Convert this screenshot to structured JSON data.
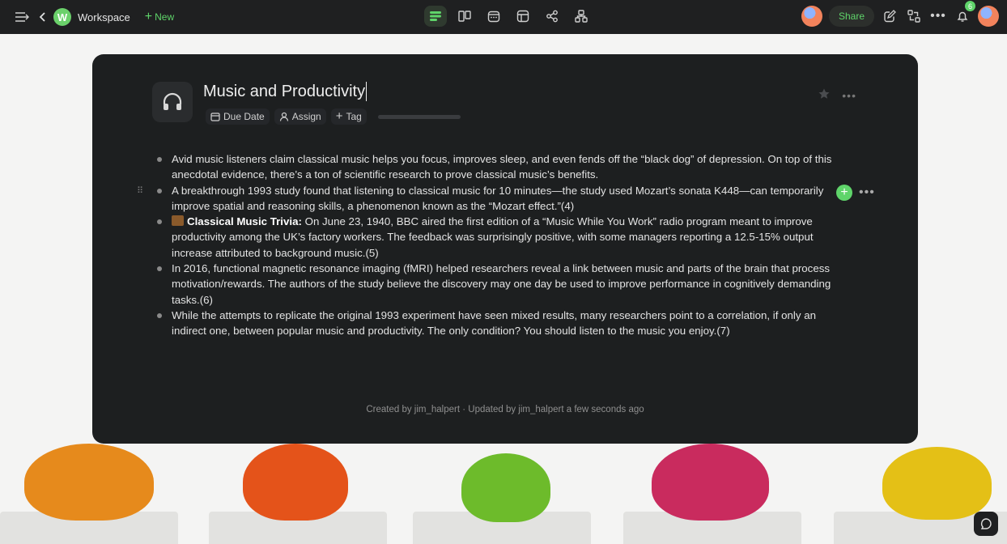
{
  "topbar": {
    "workspace_initial": "W",
    "workspace_name": "Workspace",
    "new_label": "New",
    "share_label": "Share",
    "notification_count": "6"
  },
  "doc": {
    "title": "Music and Productivity",
    "meta": {
      "due_date": "Due Date",
      "assign": "Assign",
      "tag": "Tag"
    },
    "bullets": [
      {
        "bold": "",
        "text": "Avid music listeners claim classical music helps you focus, improves sleep, and even fends off the “black dog” of depression. On top of this anecdotal evidence, there’s a ton of scientific research to prove classical music’s benefits."
      },
      {
        "bold": "",
        "text": "A breakthrough 1993 study found that listening to classical music for 10 minutes—the study used Mozart’s sonata K448—can temporarily improve spatial and reasoning skills, a phenomenon known as the “Mozart effect.”(4)"
      },
      {
        "bold": "Classical Music Trivia:",
        "text": " On June 23, 1940, BBC aired the first edition of a “Music While You Work” radio program meant to improve productivity among the UK’s factory workers. The feedback was surprisingly positive, with some managers reporting a 12.5-15% output increase attributed to background music.(5)"
      },
      {
        "bold": "",
        "text": "In 2016, functional magnetic resonance imaging (fMRI) helped researchers reveal a link between music and parts of the brain that process motivation/rewards. The authors of the study believe the discovery may one day be used to improve performance in cognitively demanding tasks.(6)"
      },
      {
        "bold": "",
        "text": "While the attempts to replicate the original 1993 experiment have seen mixed results, many researchers point to a correlation, if only an indirect one, between popular music and productivity. The only condition? You should listen to the music you enjoy.(7)"
      }
    ],
    "footer": "Created by jim_halpert · Updated by jim_halpert a few seconds ago"
  },
  "colors": {
    "accent": "#5fd46a",
    "topbar_bg": "#1f2021",
    "card_bg": "#1d1f20"
  }
}
